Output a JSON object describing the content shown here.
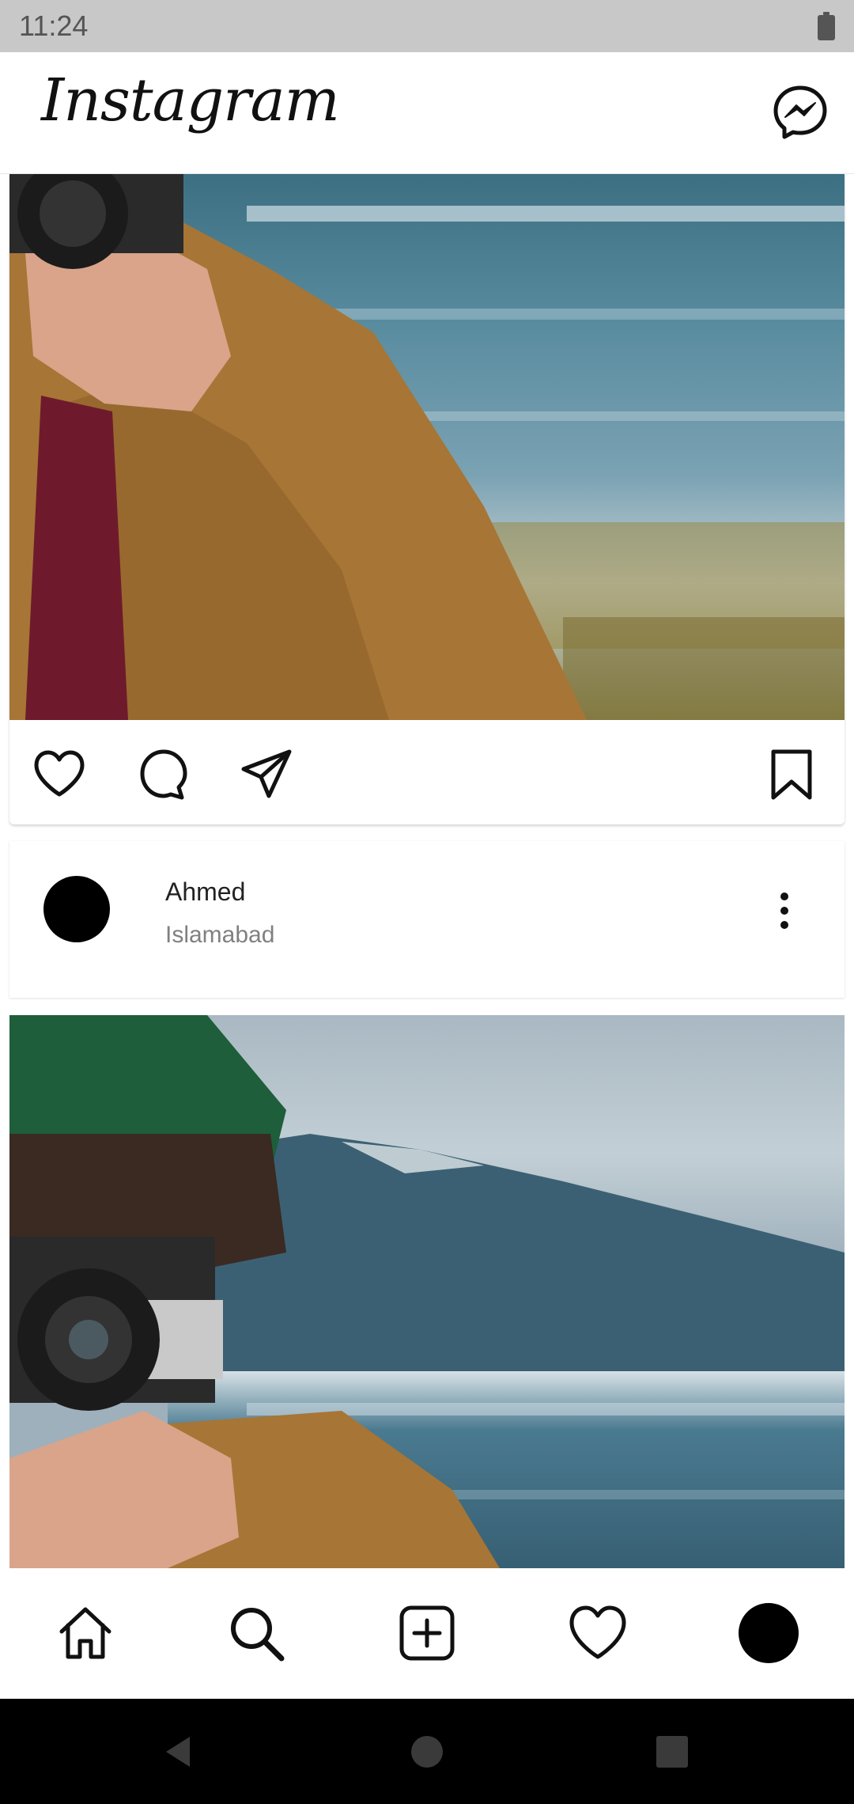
{
  "status_bar": {
    "time": "11:24"
  },
  "app_bar": {
    "title": "Instagram"
  },
  "posts": [
    {
      "user": "Ahmed",
      "location": "Islamabad"
    }
  ],
  "icons": {
    "messenger": "messenger-icon",
    "like": "heart-icon",
    "comment": "comment-icon",
    "share": "send-icon",
    "save": "bookmark-icon",
    "more": "more-vertical-icon",
    "home": "home-icon",
    "search": "search-icon",
    "add": "add-post-icon",
    "activity": "heart-icon",
    "profile": "avatar"
  },
  "colors": {
    "status_bar": "#c8c8c8",
    "background": "#ffffff",
    "text_primary": "#222222",
    "text_secondary": "#808080",
    "system_nav": "#000000"
  }
}
